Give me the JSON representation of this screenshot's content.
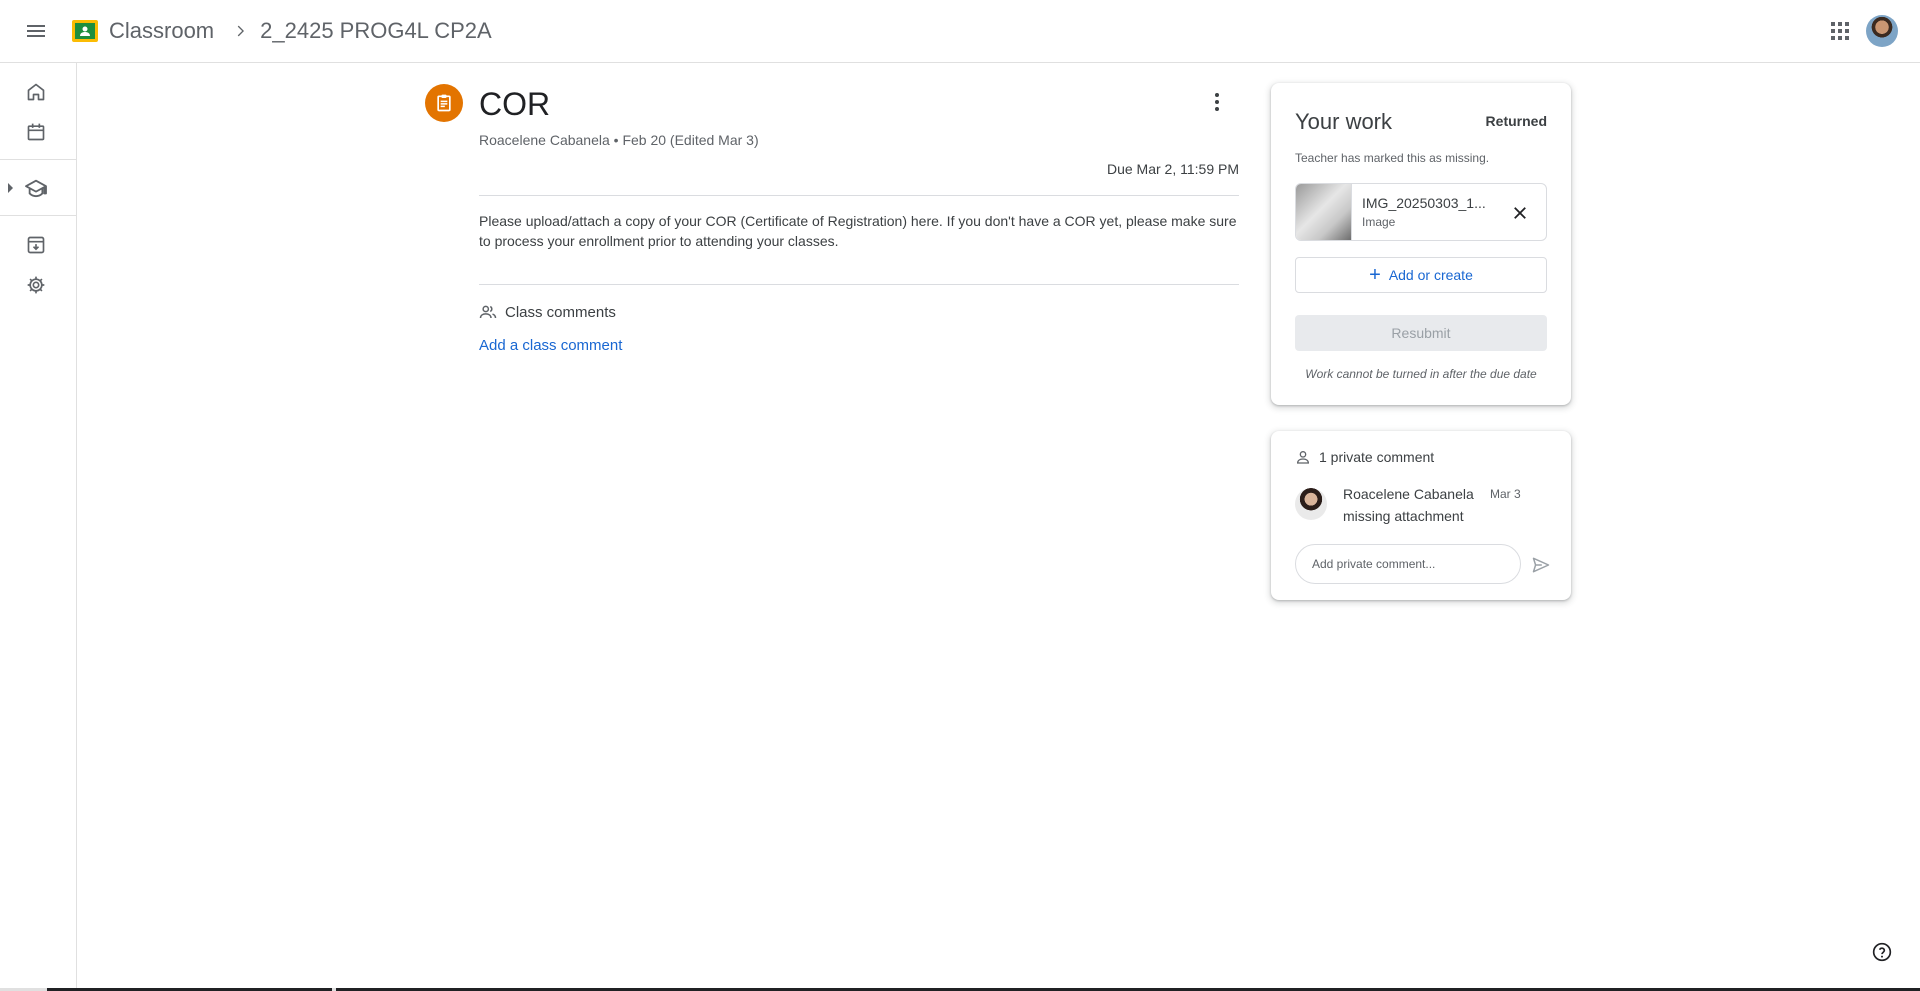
{
  "header": {
    "app_name": "Classroom",
    "class_name": "2_2425 PROG4L CP2A"
  },
  "assignment": {
    "title": "COR",
    "meta": "Roacelene Cabanela • Feb 20 (Edited Mar 3)",
    "due": "Due Mar 2, 11:59 PM",
    "description": "Please upload/attach a copy of your COR (Certificate of Registration) here. If you don't have a COR yet, please make sure to process your enrollment prior to attending your classes.",
    "class_comments_label": "Class comments",
    "add_class_comment": "Add a class comment"
  },
  "your_work": {
    "title": "Your work",
    "status": "Returned",
    "note": "Teacher has marked this as missing.",
    "attachment": {
      "name": "IMG_20250303_1...",
      "type": "Image"
    },
    "add_or_create": "Add or create",
    "resubmit": "Resubmit",
    "late_note": "Work cannot be turned in after the due date"
  },
  "private_comments": {
    "header": "1 private comment",
    "comments": [
      {
        "author": "Roacelene Cabanela",
        "date": "Mar 3",
        "text": "missing attachment"
      }
    ],
    "input_placeholder": "Add private comment..."
  },
  "colors": {
    "accent_blue": "#1967d2",
    "assignment_orange": "#e37400",
    "classroom_green": "#1e8e3e",
    "classroom_yellow": "#fbbc04"
  }
}
